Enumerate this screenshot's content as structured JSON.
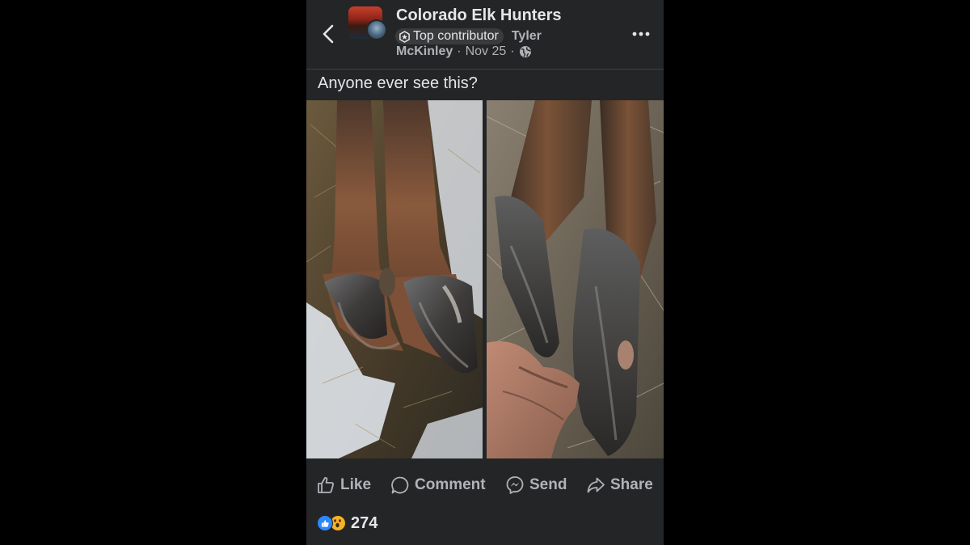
{
  "post": {
    "group_name": "Colorado Elk Hunters",
    "badge_label": "Top contributor",
    "author_first": "Tyler",
    "author_last": "McKinley",
    "date": "Nov 25",
    "separator": "·",
    "privacy_icon": "globe-icon",
    "text": "Anyone ever see this?",
    "photos": [
      {
        "name": "elk-hooves-photo-left"
      },
      {
        "name": "elk-hooves-photo-right"
      }
    ]
  },
  "actions": {
    "like_label": "Like",
    "comment_label": "Comment",
    "send_label": "Send",
    "share_label": "Share"
  },
  "reactions": {
    "icons": [
      "like-reaction-icon",
      "wow-reaction-icon"
    ],
    "count": "274"
  },
  "colors": {
    "background": "#242526",
    "text_primary": "#e4e6eb",
    "text_secondary": "#b0b3b8",
    "like_blue": "#2d88ff",
    "wow_yellow": "#f7b125"
  }
}
